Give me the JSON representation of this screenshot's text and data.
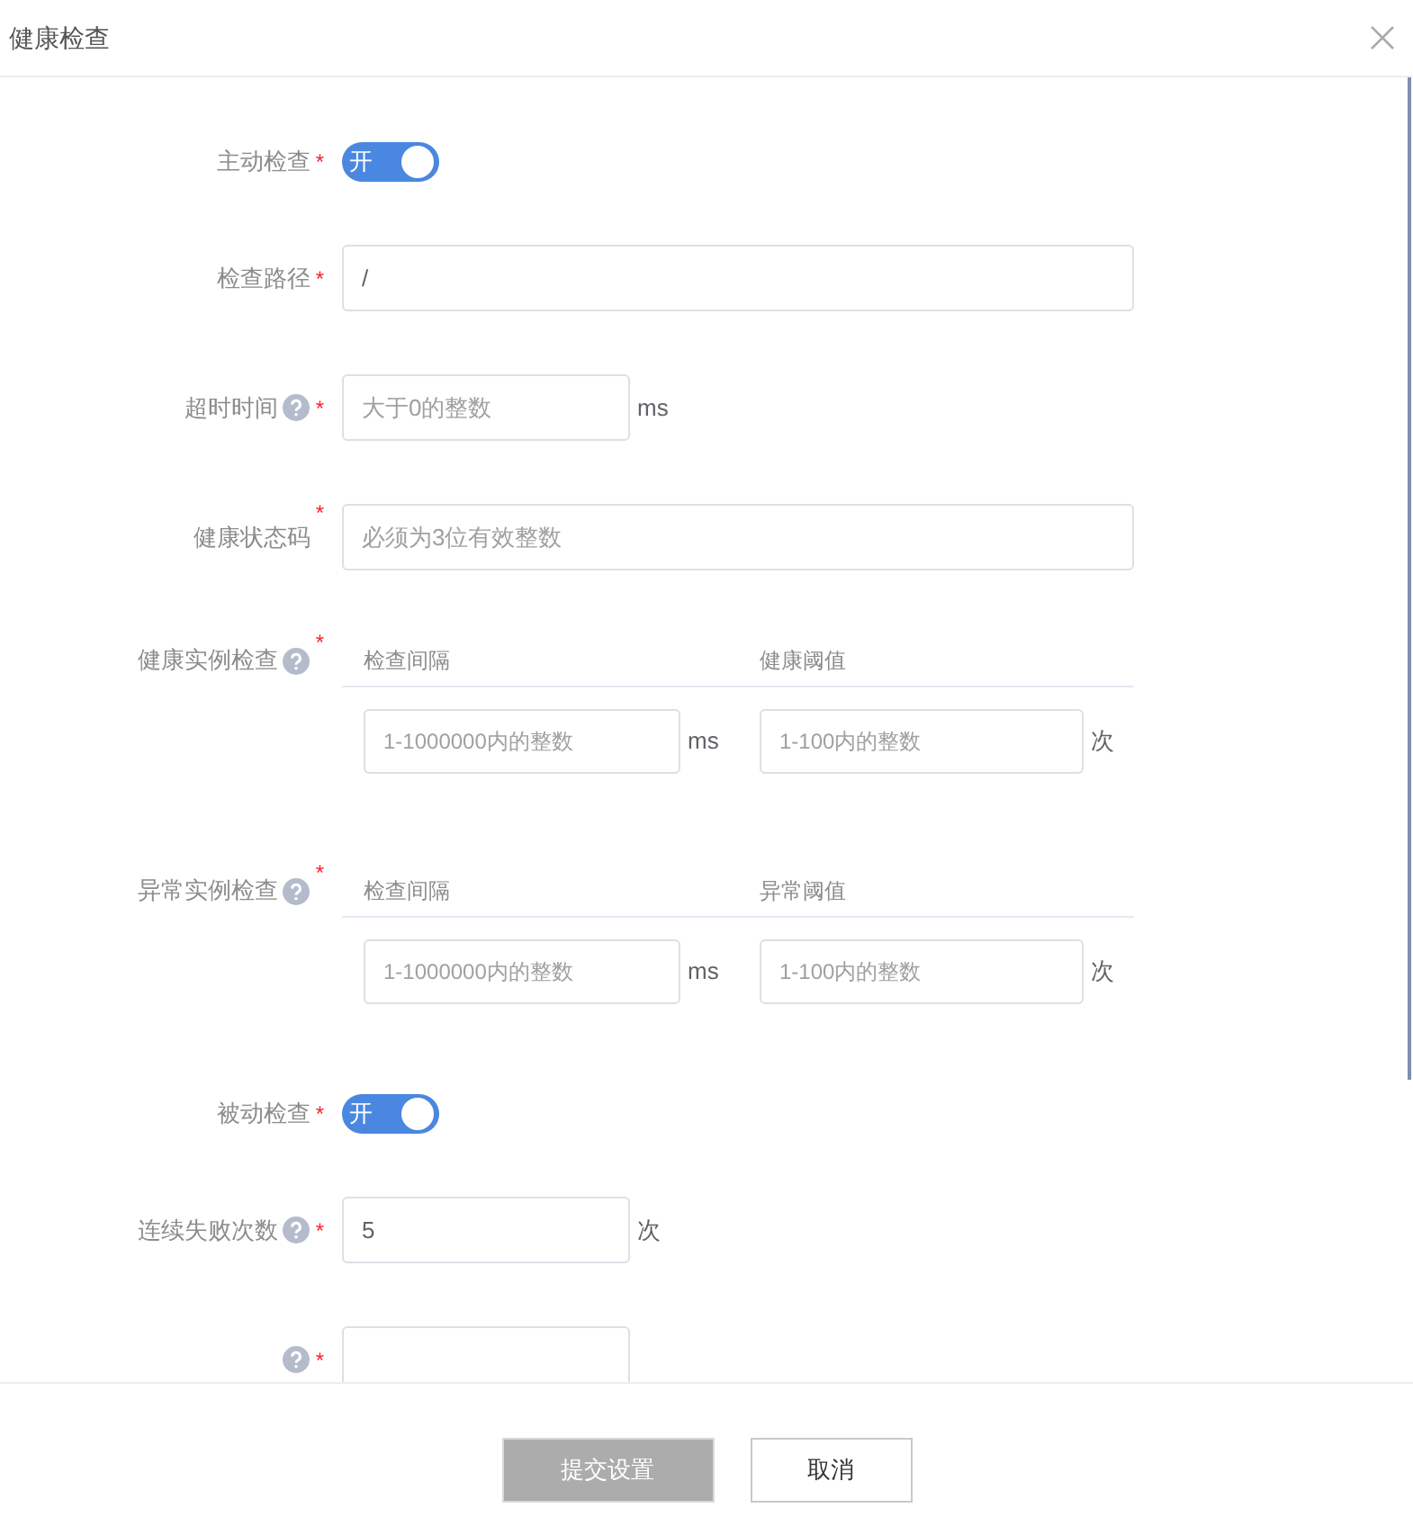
{
  "dialog": {
    "title": "健康检查"
  },
  "fields": [
    {
      "kind": "switch",
      "label": "主动检查",
      "required_mark": "*",
      "help": false,
      "on": true,
      "switch_text": "开"
    },
    {
      "kind": "wide",
      "label": "检查路径",
      "required_mark": "*",
      "help": false,
      "value": "/"
    },
    {
      "kind": "short",
      "label": "超时时间",
      "required_mark": "*",
      "help": true,
      "placeholder": "大于0的整数",
      "unit": "ms"
    },
    {
      "kind": "wide",
      "label": "健康状态码",
      "required_mark": "*",
      "help": false,
      "placeholder": "必须为3位有效整数"
    },
    {
      "kind": "pair",
      "label": "健康实例检查",
      "required_mark": "*",
      "help": true,
      "columns": [
        {
          "heading": "检查间隔",
          "placeholder": "1-1000000内的整数",
          "unit": "ms"
        },
        {
          "heading": "健康阈值",
          "placeholder": "1-100内的整数",
          "unit": "次"
        }
      ]
    },
    {
      "kind": "pair",
      "label": "异常实例检查",
      "required_mark": "*",
      "help": true,
      "columns": [
        {
          "heading": "检查间隔",
          "placeholder": "1-1000000内的整数",
          "unit": "ms"
        },
        {
          "heading": "异常阈值",
          "placeholder": "1-100内的整数",
          "unit": "次"
        }
      ]
    },
    {
      "kind": "switch",
      "label": "被动检查",
      "required_mark": "*",
      "help": false,
      "on": true,
      "switch_text": "开"
    },
    {
      "kind": "short",
      "label": "连续失败次数",
      "required_mark": "*",
      "help": true,
      "value": "5",
      "unit": "次"
    },
    {
      "kind": "short",
      "required_mark": "*",
      "help": true
    }
  ],
  "footer": {
    "buttons": [
      {
        "label": "提交设置",
        "disabled": true
      },
      {
        "label": "取消",
        "disabled": false
      }
    ]
  }
}
